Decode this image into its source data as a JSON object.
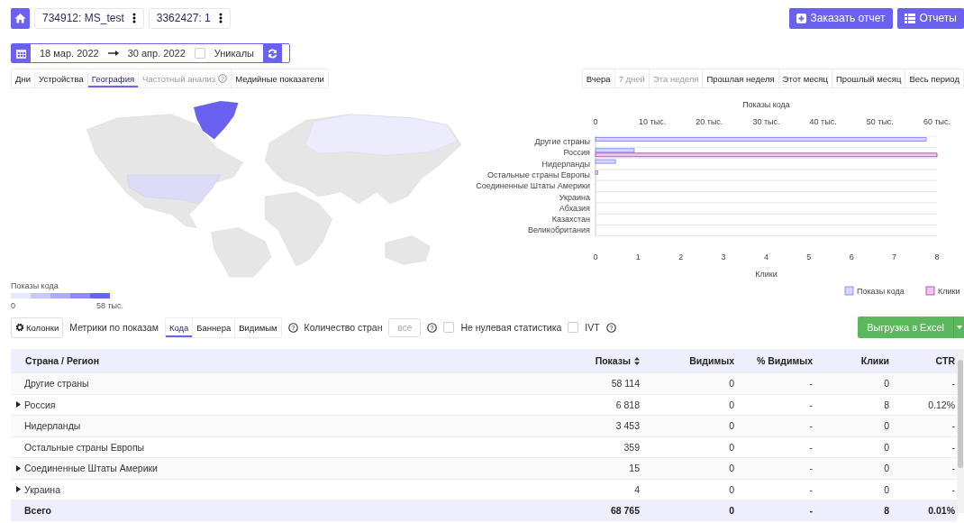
{
  "top_bar": {
    "breadcrumbs": [
      {
        "label": "734912: MS_test"
      },
      {
        "label": "3362427: 1"
      }
    ],
    "buttons": [
      {
        "kind": "order",
        "label": "Заказать отчет"
      },
      {
        "kind": "list",
        "label": "Отчеты"
      }
    ]
  },
  "date_range": {
    "from": "18 мар. 2022",
    "to": "30 апр. 2022",
    "unique": {
      "label": "Уникалы",
      "checked": false
    }
  },
  "view_tabs": [
    {
      "label": "Дни",
      "selected": false,
      "disabled": false,
      "help": false
    },
    {
      "label": "Устройства",
      "selected": false,
      "disabled": false,
      "help": false
    },
    {
      "label": "География",
      "selected": true,
      "disabled": false,
      "help": false
    },
    {
      "label": "Частотный анализ",
      "selected": false,
      "disabled": true,
      "help": true,
      "help_icon": "?"
    },
    {
      "label": "Медийные показатели",
      "selected": false,
      "disabled": false,
      "help": false
    }
  ],
  "period_tabs": [
    {
      "label": "Вчера",
      "disabled": false
    },
    {
      "label": "7 дней",
      "disabled": true
    },
    {
      "label": "Эта неделя",
      "disabled": true
    },
    {
      "label": "Прошлая неделя",
      "disabled": false
    },
    {
      "label": "Этот месяц",
      "disabled": false
    },
    {
      "label": "Прошлый месяц",
      "disabled": false
    },
    {
      "label": "Весь период",
      "disabled": false
    }
  ],
  "map_legend": {
    "title": "Показы кода",
    "min": "0",
    "max": "58 тыс."
  },
  "chart": {
    "chart_data": {
      "type": "bar",
      "orientation": "horizontal",
      "categories": [
        "Другие страны",
        "Россия",
        "Нидерланды",
        "Остальные страны Европы",
        "Соединенные Штаты Америки",
        "Украина",
        "Абхазия",
        "Казахстан",
        "Великобритания"
      ],
      "series": [
        {
          "name": "Показы кода",
          "color": "#d6d7fc",
          "axis": "x2",
          "values": [
            58.1,
            6.8,
            3.5,
            0.4,
            0,
            0,
            0,
            0,
            0
          ]
        },
        {
          "name": "Клики",
          "color": "#eec6ee",
          "values": [
            0,
            8,
            0,
            0,
            0,
            0,
            0,
            0,
            0
          ]
        }
      ],
      "x2label": "Показы кода",
      "x2lim": [
        0,
        60
      ],
      "x2ticks": [
        {
          "value": 0,
          "label": "0"
        },
        {
          "value": 10,
          "label": "10 тыс."
        },
        {
          "value": 20,
          "label": "20 тыс."
        },
        {
          "value": 30,
          "label": "30 тыс."
        },
        {
          "value": 40,
          "label": "40 тыс."
        },
        {
          "value": 50,
          "label": "50 тыс."
        },
        {
          "value": 60,
          "label": "60 тыс."
        }
      ],
      "legend": "bottom-right",
      "xlabel": "Клики",
      "xlim": [
        0,
        8
      ],
      "xticks": [
        0,
        1,
        2,
        3,
        4,
        5,
        6,
        7,
        8
      ]
    }
  },
  "toolbar": {
    "columns_button": "Колонки",
    "metrics_label": "Метрики по показам",
    "metrics": [
      {
        "label": "Кода",
        "selected": true
      },
      {
        "label": "Баннера",
        "selected": false
      },
      {
        "label": "Видимым",
        "selected": false
      }
    ],
    "metrics_help": "?",
    "count_label": "Количество стран",
    "count_placeholder": "все",
    "count_help": "?",
    "checkboxes": [
      {
        "label": "Не нулевая статистика",
        "checked": false
      },
      {
        "label": "IVT",
        "checked": false,
        "help": "?"
      }
    ],
    "export_button": "Выгрузка в Excel"
  },
  "table": {
    "columns": [
      {
        "label": "Страна / Регион",
        "sortable": false
      },
      {
        "label": "Показы",
        "sortable": true
      },
      {
        "label": "Видимых",
        "sortable": false
      },
      {
        "label": "% Видимых",
        "sortable": false
      },
      {
        "label": "Клики",
        "sortable": false
      },
      {
        "label": "CTR",
        "sortable": false
      }
    ],
    "rows": [
      {
        "expandable": false,
        "cells": [
          "Другие страны",
          "58 114",
          "0",
          "-",
          "0",
          "-"
        ]
      },
      {
        "expandable": true,
        "cells": [
          "Россия",
          "6 818",
          "0",
          "-",
          "8",
          "0.12%"
        ]
      },
      {
        "expandable": false,
        "cells": [
          "Нидерланды",
          "3 453",
          "0",
          "-",
          "0",
          "-"
        ]
      },
      {
        "expandable": false,
        "cells": [
          "Остальные страны Европы",
          "359",
          "0",
          "-",
          "0",
          "-"
        ]
      },
      {
        "expandable": true,
        "cells": [
          "Соединенные Штаты Америки",
          "15",
          "0",
          "-",
          "0",
          "-"
        ]
      },
      {
        "expandable": true,
        "cells": [
          "Украина",
          "4",
          "0",
          "-",
          "0",
          "-"
        ]
      }
    ],
    "total": [
      "Всего",
      "68 765",
      "0",
      "-",
      "8",
      "0.01%"
    ]
  }
}
